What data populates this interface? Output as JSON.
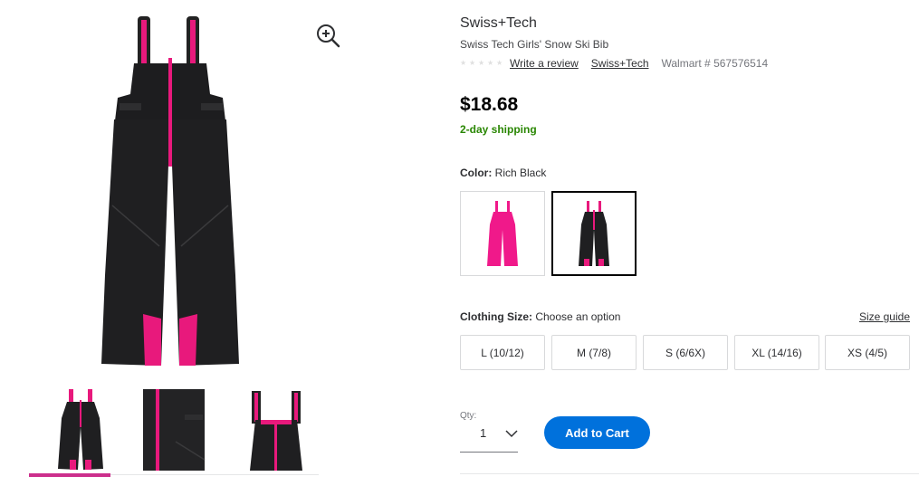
{
  "gallery": {
    "main_image_icon": "ski-bib-black-image",
    "zoom_icon": "zoom-in-icon",
    "thumbnails": [
      "ski-bib-front-thumbnail",
      "ski-bib-zipper-detail-thumbnail",
      "ski-bib-top-detail-thumbnail"
    ],
    "active_thumbnail": 0
  },
  "product": {
    "brand": "Swiss+Tech",
    "title": "Swiss Tech Girls' Snow Ski Bib",
    "write_review": "Write a review",
    "brand_link": "Swiss+Tech",
    "walmart_number": "Walmart # 567576514",
    "price": "$18.68",
    "shipping": "2-day shipping"
  },
  "color": {
    "label": "Color:",
    "selected": "Rich Black",
    "swatches": [
      "pink",
      "rich-black"
    ]
  },
  "size": {
    "label": "Clothing Size:",
    "prompt": "Choose an option",
    "guide": "Size guide",
    "options": [
      "L (10/12)",
      "M (7/8)",
      "S (6/6X)",
      "XL (14/16)",
      "XS (4/5)"
    ]
  },
  "purchase": {
    "qty_label": "Qty:",
    "qty_value": "1",
    "add_to_cart": "Add to Cart"
  },
  "colors": {
    "accent_blue": "#0071dc",
    "shipping_green": "#2a8703",
    "thumb_indicator": "#cc2f8c",
    "product_pink": "#e8197c"
  }
}
